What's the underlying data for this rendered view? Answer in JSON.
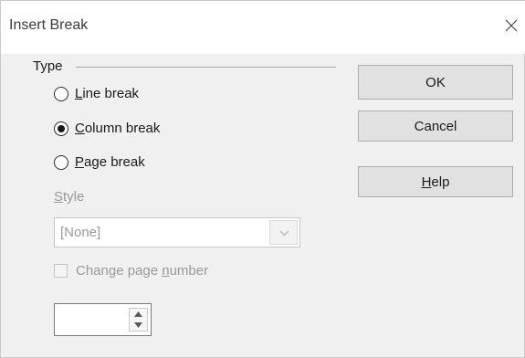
{
  "window": {
    "title": "Insert Break",
    "close_icon": "close-icon"
  },
  "type_group": {
    "label": "Type",
    "options": [
      {
        "mnemonic": "L",
        "rest": "ine break",
        "checked": false
      },
      {
        "mnemonic": "C",
        "rest": "olumn break",
        "checked": true
      },
      {
        "mnemonic": "P",
        "rest": "age break",
        "checked": false
      }
    ]
  },
  "style": {
    "label_mnemonic": "S",
    "label_rest": "tyle",
    "value": "[None]",
    "disabled": true
  },
  "change_page_number": {
    "label_before": "Change page ",
    "label_mnemonic": "n",
    "label_after": "umber",
    "checked": false,
    "disabled": true
  },
  "page_number_spin": {
    "value": ""
  },
  "buttons": {
    "ok": "OK",
    "cancel": "Cancel",
    "help_mnemonic": "H",
    "help_rest": "elp"
  }
}
